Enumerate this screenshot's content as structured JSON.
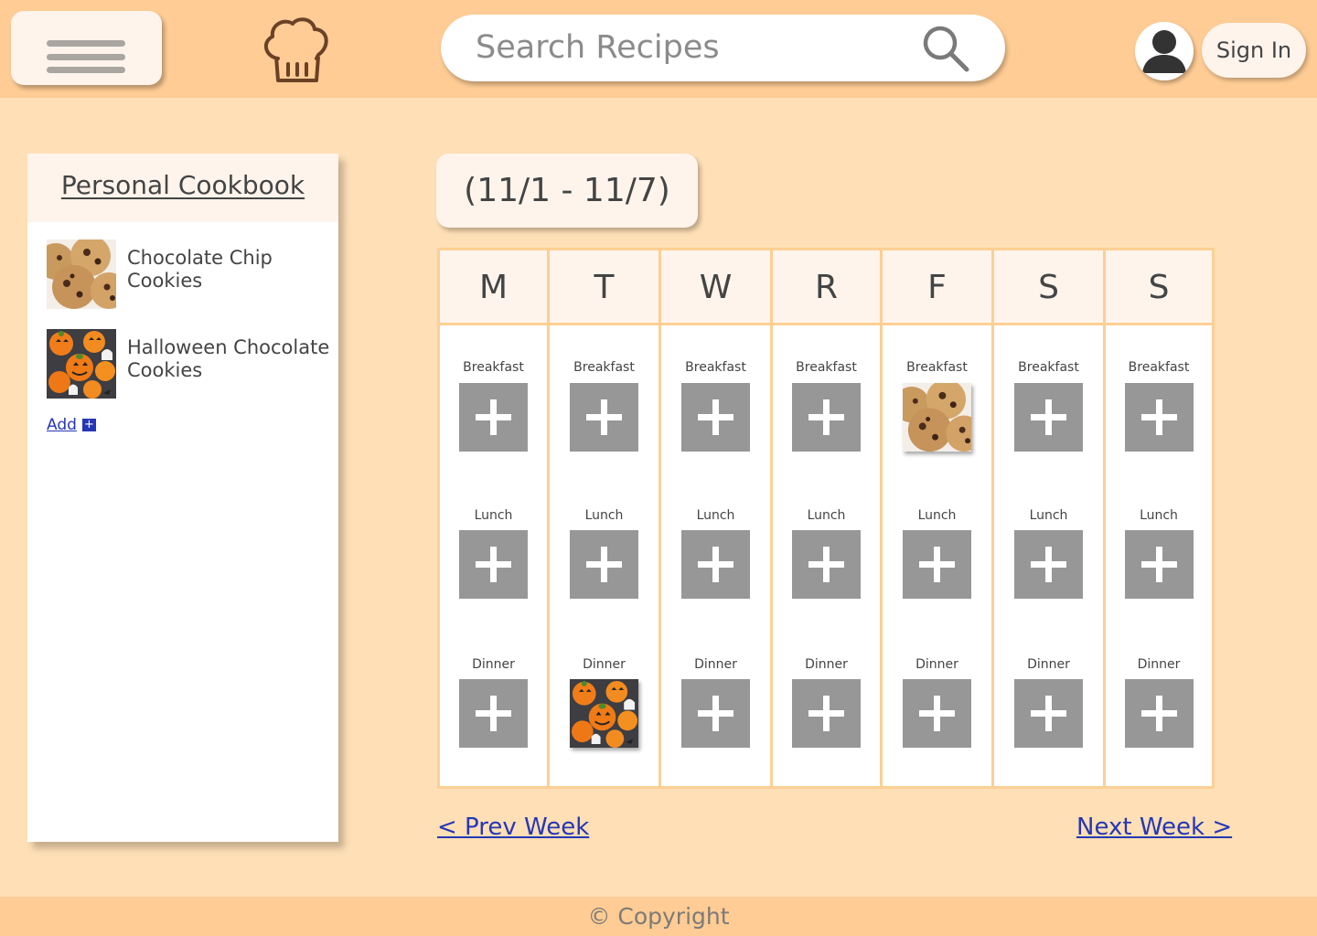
{
  "header": {
    "search_placeholder": "Search Recipes",
    "sign_in_label": "Sign In"
  },
  "sidebar": {
    "title": "Personal Cookbook",
    "recipes": [
      {
        "name": "Chocolate Chip Cookies",
        "image": "chocolate-chip-cookies"
      },
      {
        "name": "Halloween Chocolate Cookies",
        "image": "halloween-chocolate-cookies"
      }
    ],
    "add_label": "Add",
    "add_icon": "+"
  },
  "planner": {
    "week_range": "(11/1 - 11/7)",
    "days": [
      "M",
      "T",
      "W",
      "R",
      "F",
      "S",
      "S"
    ],
    "meals": [
      "Breakfast",
      "Lunch",
      "Dinner"
    ],
    "assignments": [
      {
        "day": 4,
        "meal": "Breakfast",
        "recipe": "Chocolate Chip Cookies"
      },
      {
        "day": 1,
        "meal": "Dinner",
        "recipe": "Halloween Chocolate Cookies"
      }
    ],
    "prev_label": "< Prev Week",
    "next_label": "Next Week >"
  },
  "footer": {
    "copyright": "© Copyright"
  },
  "colors": {
    "page_bg": "#fedfb6",
    "header_bg": "#fecc94",
    "panel_light": "#fef4ec",
    "grid_border": "#fdcf94",
    "empty_slot": "#979797",
    "link": "#2637b5"
  }
}
